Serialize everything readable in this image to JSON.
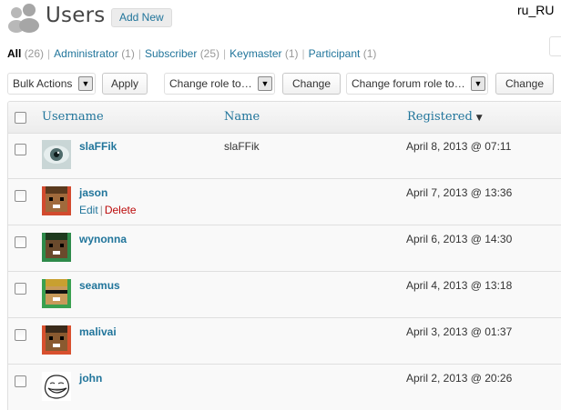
{
  "header": {
    "title": "Users",
    "add_new_label": "Add New",
    "icon": "users-icon",
    "locale": "ru_RU"
  },
  "filters": [
    {
      "label": "All",
      "count": "(26)",
      "current": true
    },
    {
      "label": "Administrator",
      "count": "(1)"
    },
    {
      "label": "Subscriber",
      "count": "(25)"
    },
    {
      "label": "Keymaster",
      "count": "(1)"
    },
    {
      "label": "Participant",
      "count": "(1)"
    }
  ],
  "toolbar": {
    "bulk_actions": "Bulk Actions",
    "apply_label": "Apply",
    "change_role": "Change role to…",
    "change_label": "Change",
    "change_forum_role": "Change forum role to…",
    "change_forum_label": "Change"
  },
  "table": {
    "columns": {
      "username": "Username",
      "name": "Name",
      "registered": "Registered"
    },
    "rows": [
      {
        "username": "slaFFik",
        "name": "slaFFik",
        "registered": "April 8, 2013 @ 07:11",
        "avatar": "eye-avatar-icon"
      },
      {
        "username": "jason",
        "name": "",
        "registered": "April 7, 2013 @ 13:36",
        "avatar": "pixel-face-avatar-icon",
        "actions": {
          "edit": "Edit",
          "sep": "|",
          "delete": "Delete"
        }
      },
      {
        "username": "wynonna",
        "name": "",
        "registered": "April 6, 2013 @ 14:30",
        "avatar": "pixel-face-avatar-icon"
      },
      {
        "username": "seamus",
        "name": "",
        "registered": "April 4, 2013 @ 13:18",
        "avatar": "pixel-face-avatar-icon"
      },
      {
        "username": "malivai",
        "name": "",
        "registered": "April 3, 2013 @ 01:37",
        "avatar": "pixel-face-avatar-icon"
      },
      {
        "username": "john",
        "name": "",
        "registered": "April 2, 2013 @ 20:26",
        "avatar": "trollface-avatar-icon"
      }
    ]
  },
  "colors": {
    "link": "#21759b",
    "delete": "#bc0b0b"
  }
}
